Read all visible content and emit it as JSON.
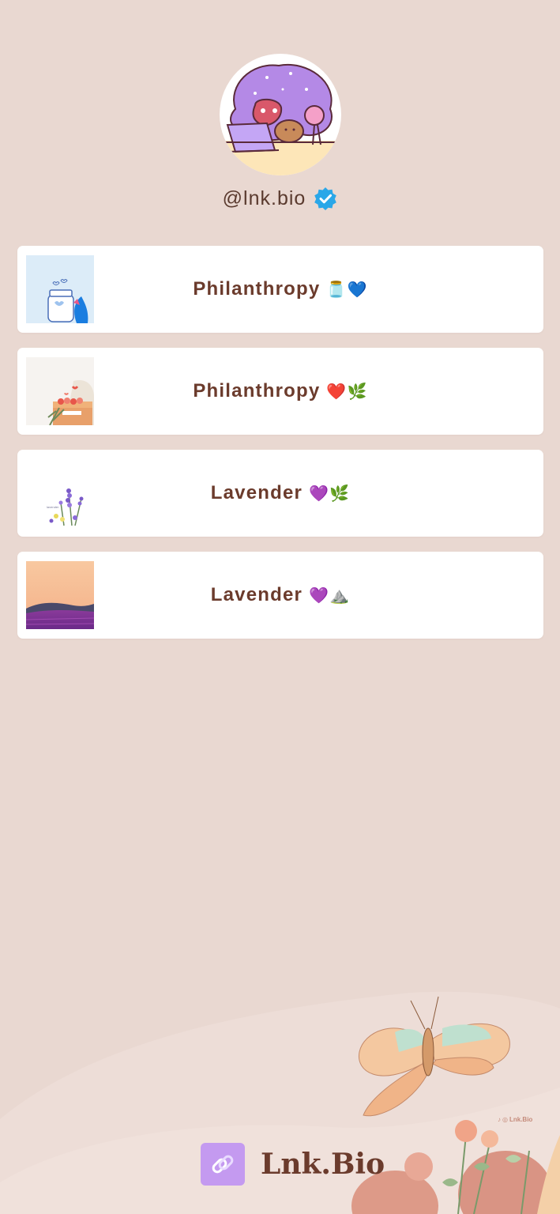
{
  "profile": {
    "handle": "@lnk.bio",
    "verified_icon": "verified-check-icon",
    "verified_color": "#2aa7e8"
  },
  "links": [
    {
      "label": "Philanthropy",
      "emoji": "🫙💙",
      "thumb": "jar-of-hearts-thumbnail"
    },
    {
      "label": "Philanthropy",
      "emoji": "❤️🌿",
      "thumb": "donation-box-thumbnail"
    },
    {
      "label": "Lavender",
      "emoji": "💜🌿",
      "thumb": "lavender-flowers-thumbnail"
    },
    {
      "label": "Lavender",
      "emoji": "💜⛰️",
      "thumb": "lavender-field-thumbnail"
    }
  ],
  "footer": {
    "brand_name": "Lnk.Bio",
    "watermark": "Lnk.Bio",
    "brand_color": "#c49af0"
  },
  "colors": {
    "background": "#e9d8d1",
    "text": "#6b3b2c",
    "card": "#ffffff"
  }
}
